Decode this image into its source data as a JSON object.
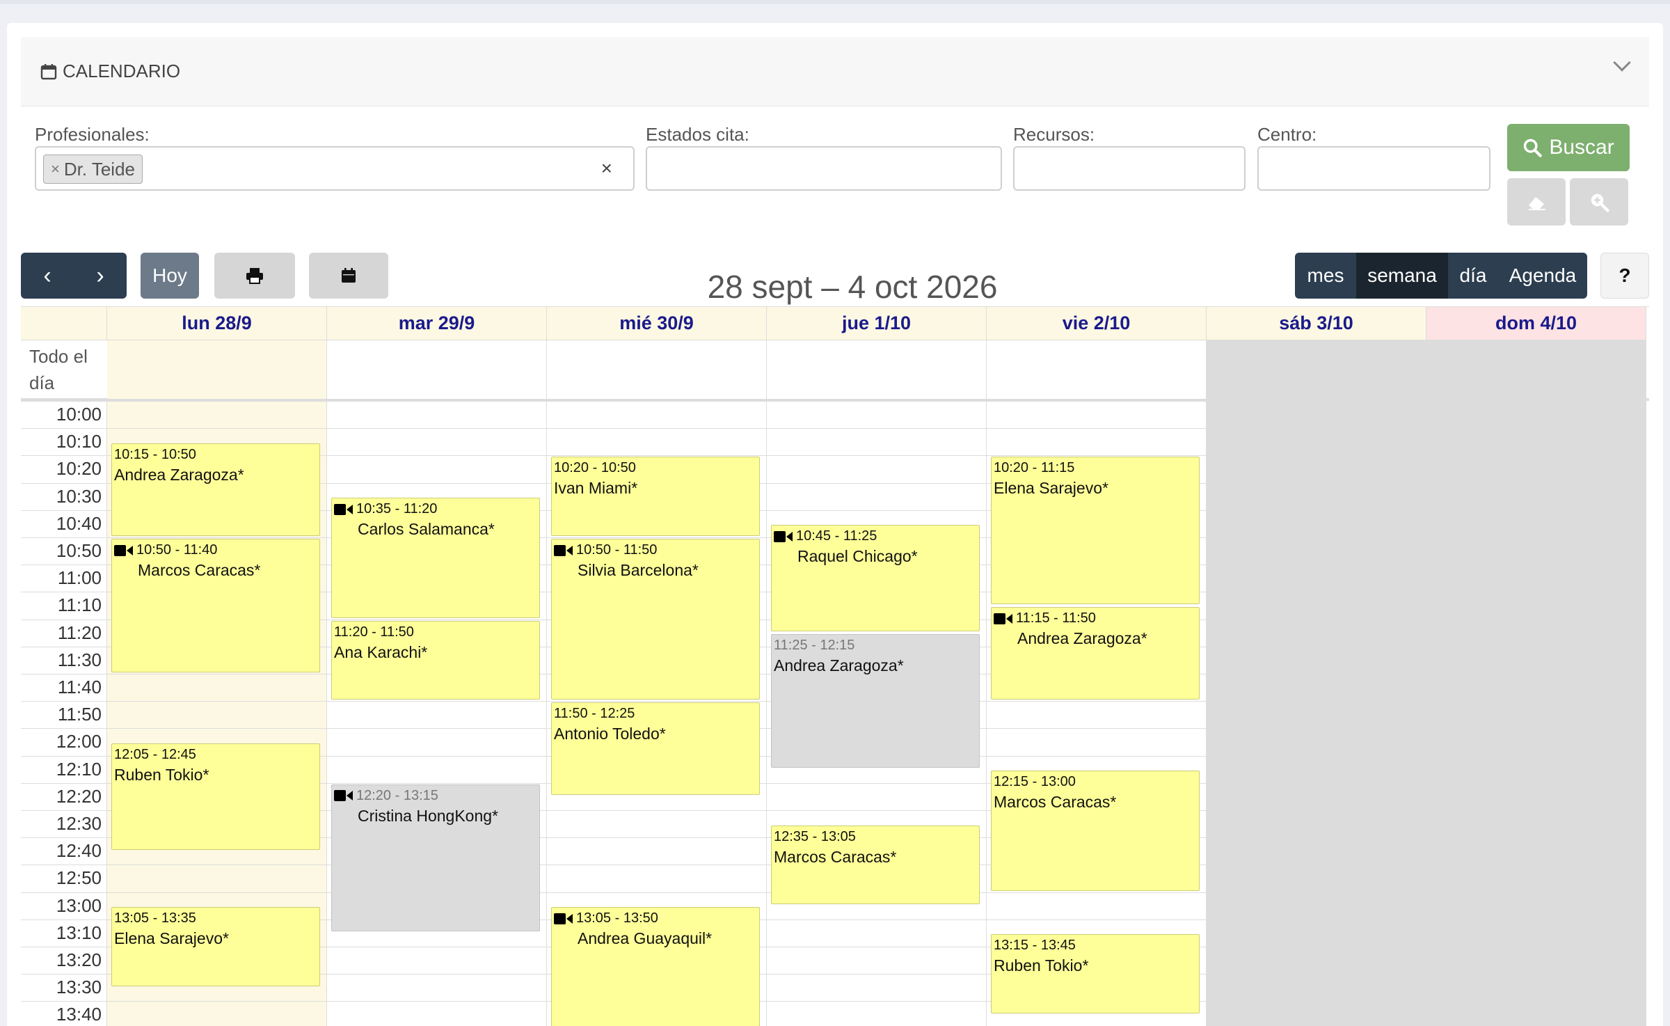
{
  "panel": {
    "title": "CALENDARIO"
  },
  "filters": {
    "profesionales_label": "Profesionales:",
    "profesionales_tag": "Dr. Teide",
    "estados_label": "Estados cita:",
    "recursos_label": "Recursos:",
    "centro_label": "Centro:",
    "buscar_label": "Buscar"
  },
  "toolbar": {
    "hoy_label": "Hoy",
    "views": [
      "mes",
      "semana",
      "día",
      "Agenda"
    ],
    "active_view": "semana",
    "help_label": "?"
  },
  "range_title": "28 sept – 4 oct 2026",
  "allday_label": "Todo el día",
  "days": [
    "lun 28/9",
    "mar 29/9",
    "mié 30/9",
    "jue 1/10",
    "vie 2/10",
    "sáb 3/10",
    "dom 4/10"
  ],
  "times": [
    "10:00",
    "10:10",
    "10:20",
    "10:30",
    "10:40",
    "10:50",
    "11:00",
    "11:10",
    "11:20",
    "11:30",
    "11:40",
    "11:50",
    "12:00",
    "12:10",
    "12:20",
    "12:30",
    "12:40",
    "12:50",
    "13:00",
    "13:10",
    "13:20",
    "13:30",
    "13:40"
  ],
  "events": [
    {
      "day": 0,
      "time": "10:15 - 10:50",
      "name": "Andrea Zaragoza*",
      "video": false,
      "status": "pending"
    },
    {
      "day": 0,
      "time": "10:50 - 11:40",
      "name": "Marcos Caracas*",
      "video": true,
      "status": "pending"
    },
    {
      "day": 0,
      "time": "12:05 - 12:45",
      "name": "Ruben Tokio*",
      "video": false,
      "status": "pending"
    },
    {
      "day": 0,
      "time": "13:05 - 13:35",
      "name": "Elena Sarajevo*",
      "video": false,
      "status": "pending"
    },
    {
      "day": 1,
      "time": "10:35 - 11:20",
      "name": "Carlos Salamanca*",
      "video": true,
      "status": "pending"
    },
    {
      "day": 1,
      "time": "11:20 - 11:50",
      "name": "Ana Karachi*",
      "video": false,
      "status": "pending"
    },
    {
      "day": 1,
      "time": "12:20 - 13:15",
      "name": "Cristina HongKong*",
      "video": true,
      "status": "grey"
    },
    {
      "day": 2,
      "time": "10:20 - 10:50",
      "name": "Ivan Miami*",
      "video": false,
      "status": "pending"
    },
    {
      "day": 2,
      "time": "10:50 - 11:50",
      "name": "Silvia Barcelona*",
      "video": true,
      "status": "pending"
    },
    {
      "day": 2,
      "time": "11:50 - 12:25",
      "name": "Antonio Toledo*",
      "video": false,
      "status": "pending"
    },
    {
      "day": 2,
      "time": "13:05 - 13:50",
      "name": "Andrea Guayaquil*",
      "video": true,
      "status": "pending"
    },
    {
      "day": 3,
      "time": "10:45 - 11:25",
      "name": "Raquel Chicago*",
      "video": true,
      "status": "pending"
    },
    {
      "day": 3,
      "time": "11:25 - 12:15",
      "name": "Andrea Zaragoza*",
      "video": false,
      "status": "grey"
    },
    {
      "day": 3,
      "time": "12:35 - 13:05",
      "name": "Marcos Caracas*",
      "video": false,
      "status": "pending"
    },
    {
      "day": 4,
      "time": "10:20 - 11:15",
      "name": "Elena Sarajevo*",
      "video": false,
      "status": "pending"
    },
    {
      "day": 4,
      "time": "11:15 - 11:50",
      "name": "Andrea Zaragoza*",
      "video": true,
      "status": "pending"
    },
    {
      "day": 4,
      "time": "12:15 - 13:00",
      "name": "Marcos Caracas*",
      "video": false,
      "status": "pending"
    },
    {
      "day": 4,
      "time": "13:15 - 13:45",
      "name": "Ruben Tokio*",
      "video": false,
      "status": "pending"
    }
  ],
  "colors": {
    "event_yellow": "#ffff99",
    "event_grey": "#dcdcdc",
    "today_bg": "#fcf8e3",
    "sunday_head": "#fde3e3",
    "weekend_bg": "#dcdcdc",
    "header_text": "#1a1a8c"
  }
}
